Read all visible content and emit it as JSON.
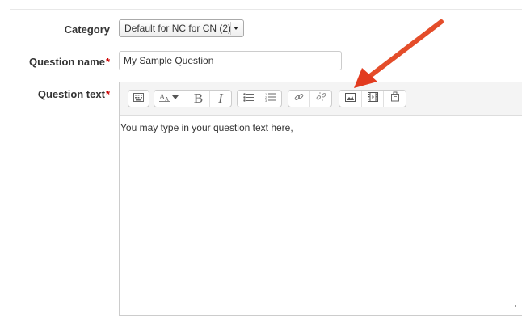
{
  "form": {
    "category": {
      "label": "Category",
      "value": "Default for NC for CN (2)"
    },
    "question_name": {
      "label": "Question name",
      "required_marker": "*",
      "value": "My Sample Question"
    },
    "question_text": {
      "label": "Question text",
      "required_marker": "*",
      "content": "You may type in your question text here,"
    }
  },
  "toolbar": {
    "buttons": [
      {
        "group": 1,
        "icon": "toolbar-toggle-icon"
      },
      {
        "group": 2,
        "icon": "font-style-icon"
      },
      {
        "group": 2,
        "icon": "bold-icon",
        "text": "B"
      },
      {
        "group": 2,
        "icon": "italic-icon",
        "text": "I"
      },
      {
        "group": 3,
        "icon": "unordered-list-icon"
      },
      {
        "group": 3,
        "icon": "ordered-list-icon"
      },
      {
        "group": 4,
        "icon": "link-icon"
      },
      {
        "group": 4,
        "icon": "unlink-icon"
      },
      {
        "group": 5,
        "icon": "image-icon"
      },
      {
        "group": 5,
        "icon": "media-icon"
      },
      {
        "group": 5,
        "icon": "file-manage-icon"
      }
    ]
  },
  "annotation": {
    "icon": "red-arrow-pointer",
    "color": "#e8411d"
  },
  "colors": {
    "required": "#cc0000",
    "border": "#cccccc",
    "toolbar_bg": "#f4f4f4"
  }
}
